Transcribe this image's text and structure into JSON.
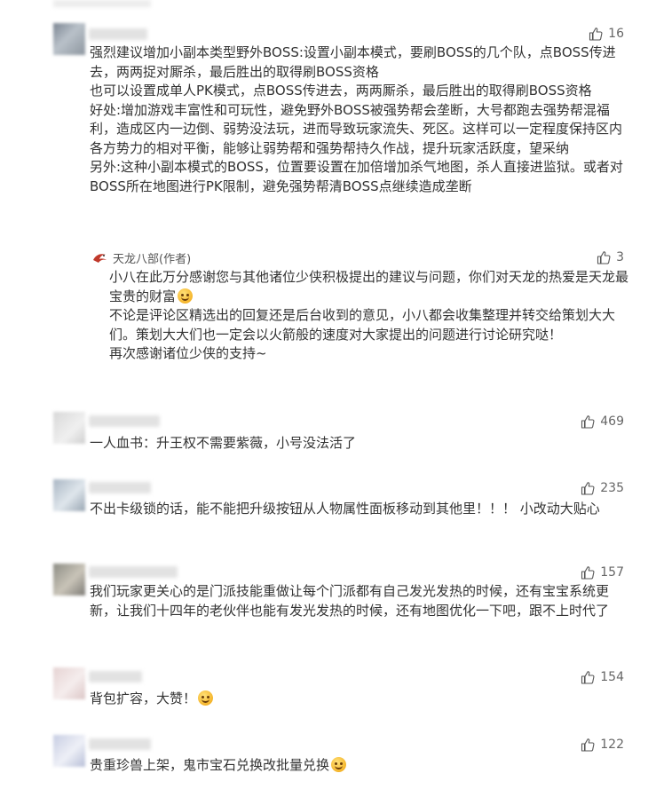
{
  "comments": [
    {
      "likes": "16",
      "paragraphs": [
        "强烈建议增加小副本类型野外BOSS:设置小副本模式，要刷BOSS的几个队，点BOSS传进去，两两捉对厮杀，最后胜出的取得刷BOSS资格",
        "也可以设置成单人PK模式，点BOSS传进去，两两厮杀，最后胜出的取得刷BOSS资格",
        "好处:增加游戏丰富性和可玩性，避免野外BOSS被强势帮会垄断，大号都跑去强势帮混福利，造成区内一边倒、弱势没法玩，进而导致玩家流失、死区。这样可以一定程度保持区内各方势力的相对平衡，能够让弱势帮和强势帮持久作战，提升玩家活跃度，望采纳",
        "另外:这种小副本模式的BOSS，位置要设置在加倍增加杀气地图，杀人直接进监狱。或者对BOSS所在地图进行PK限制，避免强势帮清BOSS点继续造成垄断"
      ],
      "reply": {
        "author": "天龙八部(作者)",
        "likes": "3",
        "p1": "小八在此万分感谢您与其他诸位少侠积极提出的建议与问题，你们对天龙的热爱是天龙最宝贵的财富",
        "p2": "不论是评论区精选出的回复还是后台收到的意见，小八都会收集整理并转交给策划大大们。策划大大们也一定会以火箭般的速度对大家提出的问题进行讨论研究哒！",
        "p3": "再次感谢诸位少侠的支持~"
      }
    },
    {
      "likes": "469",
      "text": "一人血书：升王权不需要紫薇，小号没法活了"
    },
    {
      "likes": "235",
      "text": "不出卡级锁的话，能不能把升级按钮从人物属性面板移动到其他里！！！ 小改动大贴心"
    },
    {
      "likes": "157",
      "text": "我们玩家更关心的是门派技能重做让每个门派都有自己发光发热的时候，还有宝宝系统更新，让我们十四年的老伙伴也能有发光发热的时候，还有地图优化一下吧，跟不上时代了"
    },
    {
      "likes": "154",
      "text": "背包扩容，大赞！"
    },
    {
      "likes": "122",
      "text": "贵重珍兽上架，鬼市宝石兑换改批量兑换"
    }
  ],
  "colors": {
    "text": "#333333",
    "like_icon": "#555555",
    "author": "#555555"
  },
  "icons": {
    "like": "thumbs-up-icon",
    "author_logo": "tianlong-logo-icon",
    "emoji": "smile-emoji"
  }
}
